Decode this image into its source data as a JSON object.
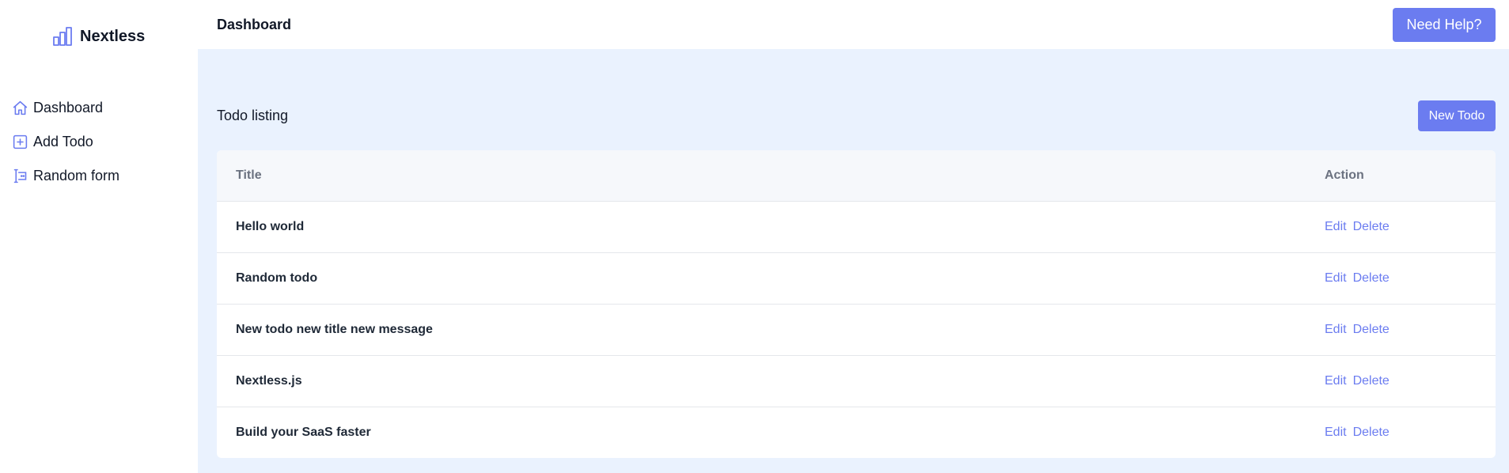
{
  "brand": {
    "name": "Nextless"
  },
  "sidebar": {
    "items": [
      {
        "label": "Dashboard",
        "icon": "home-icon"
      },
      {
        "label": "Add Todo",
        "icon": "plus-square-icon"
      },
      {
        "label": "Random form",
        "icon": "form-input-icon"
      }
    ]
  },
  "header": {
    "title": "Dashboard",
    "help_label": "Need Help?"
  },
  "todos": {
    "title": "Todo listing",
    "new_label": "New Todo",
    "columns": [
      "Title",
      "Action"
    ],
    "edit_label": "Edit",
    "delete_label": "Delete",
    "rows": [
      {
        "title": "Hello world"
      },
      {
        "title": "Random todo"
      },
      {
        "title": "New todo new title new message"
      },
      {
        "title": "Nextless.js"
      },
      {
        "title": "Build your SaaS faster"
      }
    ]
  },
  "colors": {
    "accent": "#6b7cf0",
    "main_bg": "#eaf2fe",
    "header_row_bg": "#f6f8fb"
  }
}
